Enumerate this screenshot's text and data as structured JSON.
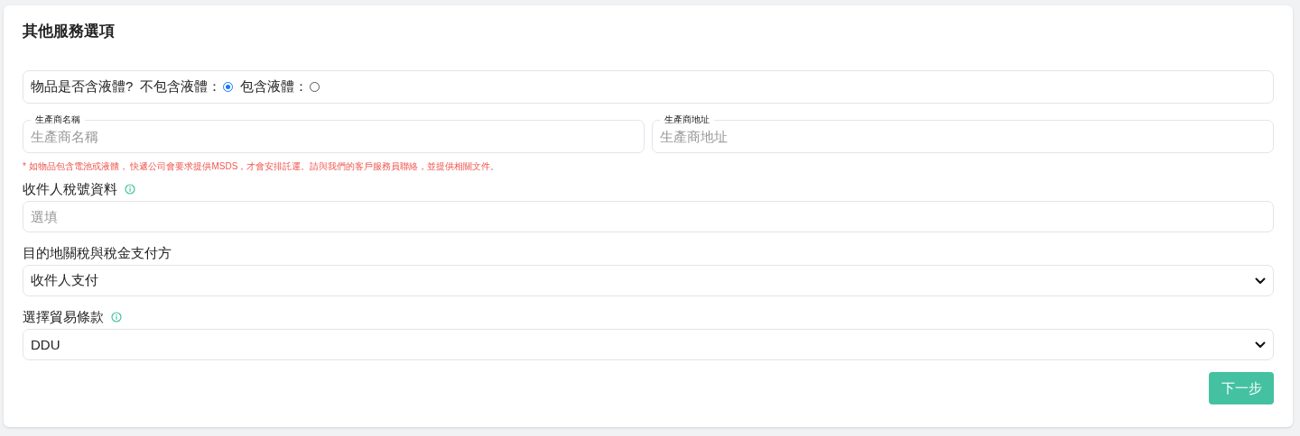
{
  "title": "其他服務選項",
  "liquid": {
    "question": "物品是否含液體?",
    "options": [
      {
        "label": "不包含液體：",
        "selected": true
      },
      {
        "label": "包含液體：",
        "selected": false
      }
    ]
  },
  "manufacturer_fields": [
    {
      "label": "生產商名稱",
      "placeholder": "生產商名稱"
    },
    {
      "label": "生產商地址",
      "placeholder": "生產商地址"
    }
  ],
  "note": "* 如物品包含電池或液體， 快遞公司會要求提供MSDS，才會安排託運。請與我們的客戶服務員聯絡，並提供相關文件。",
  "fields": [
    {
      "kind": "input",
      "label": "收件人稅號資料",
      "info": true,
      "placeholder": "選填"
    },
    {
      "kind": "select",
      "label": "目的地關稅與稅金支付方",
      "info": false,
      "value": "收件人支付"
    },
    {
      "kind": "select",
      "label": "選擇貿易條款",
      "info": true,
      "value": "DDU"
    }
  ],
  "next_button": "下一步"
}
